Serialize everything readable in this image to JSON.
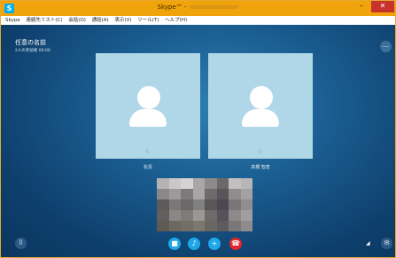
{
  "window": {
    "title": "Skype™ -",
    "app_icon": "S",
    "minimize": "–",
    "close": "✕"
  },
  "menu": [
    "Skype",
    "連絡先リスト(C)",
    "会話(O)",
    "通話(A)",
    "表示(V)",
    "ツール(T)",
    "ヘルプ(H)"
  ],
  "call": {
    "title": "任意の名前",
    "subtitle": "2人の参加者  00:00",
    "more_label": "…"
  },
  "participants": [
    {
      "name": "松島",
      "mic_mark": "♁"
    },
    {
      "name": "高橋 智恵",
      "mic_mark": "♁"
    }
  ],
  "self_video_colors": [
    "#b6b3b5",
    "#c9c7c8",
    "#d5d3d4",
    "#a9a6a8",
    "#8e8a8c",
    "#6b6868",
    "#c2c0c1",
    "#b8b5b6",
    "#8a8889",
    "#9c9a9b",
    "#7c7a7b",
    "#a8a6a7",
    "#6e6a6c",
    "#58545a",
    "#8f8d8e",
    "#a3a1a2",
    "#5c5a5b",
    "#7a7879",
    "#6a6869",
    "#808080",
    "#5a5658",
    "#4c4850",
    "#787677",
    "#908e8f",
    "#62605f",
    "#8a8885",
    "#7f7b78",
    "#9a9794",
    "#6d6a6b",
    "#55525a",
    "#8c8a8b",
    "#a09e9f",
    "#5e5a55",
    "#6e6960",
    "#726d66",
    "#7c786f",
    "#6a6663",
    "#5e5b60",
    "#7a7778",
    "#8e8c8d"
  ],
  "controls": {
    "video": "■",
    "mic": "♪",
    "add": "+",
    "hangup": "☎"
  },
  "side": {
    "dialpad": "⠿",
    "signal": "◢",
    "chat": "✉"
  }
}
